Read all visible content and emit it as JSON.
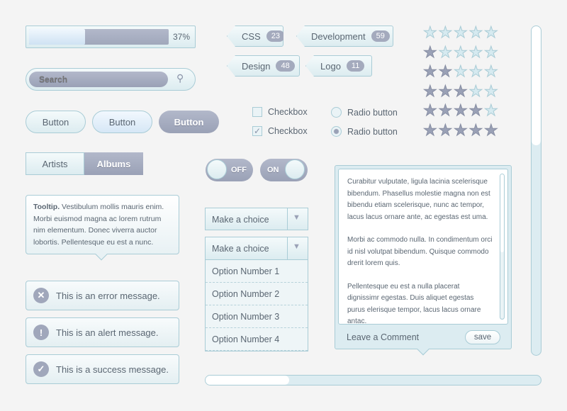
{
  "progress": {
    "value": 37,
    "label": "37%"
  },
  "search": {
    "placeholder": "Search"
  },
  "buttons": [
    "Button",
    "Button",
    "Button"
  ],
  "segmented": {
    "items": [
      "Artists",
      "Albums"
    ],
    "selected": 1
  },
  "tooltip": {
    "title": "Tooltip.",
    "body": "Vestibulum mollis mauris enim. Morbi euismod magna ac lorem rutrum nim elementum. Donec viverra auctor lobortis. Pellentesque eu est a nunc."
  },
  "messages": [
    {
      "icon": "error-icon",
      "glyph": "✕",
      "text": "This is an error message."
    },
    {
      "icon": "alert-icon",
      "glyph": "!",
      "text": "This is an alert message."
    },
    {
      "icon": "success-icon",
      "glyph": "✓",
      "text": "This is a success message."
    }
  ],
  "tags": [
    {
      "label": "CSS",
      "count": "23"
    },
    {
      "label": "Development",
      "count": "59"
    },
    {
      "label": "Design",
      "count": "48"
    },
    {
      "label": "Logo",
      "count": "11"
    }
  ],
  "checkboxes": [
    {
      "label": "Checkbox",
      "checked": false
    },
    {
      "label": "Checkbox",
      "checked": true
    }
  ],
  "radios": [
    {
      "label": "Radio button",
      "checked": false
    },
    {
      "label": "Radio button",
      "checked": true
    }
  ],
  "toggles": {
    "off": "OFF",
    "on": "ON"
  },
  "select1": {
    "value": "Make a choice"
  },
  "select2": {
    "value": "Make a choice",
    "options": [
      "Option Number 1",
      "Option Number 2",
      "Option Number 3",
      "Option Number 4"
    ]
  },
  "ratings": [
    0,
    1,
    2,
    3,
    4,
    5
  ],
  "comment": {
    "paragraphs": [
      "Curabitur vulputate, ligula lacinia scelerisque bibendum. Phasellus molestie magna non est bibendu etiam scelerisque, nunc ac tempor, lacus lacus ornare ante, ac egestas est uma.",
      "Morbi ac commodo nulla. In condimentum orci id nisl volutpat bibendum. Quisque commodo drerit lorem quis.",
      "Pellentesque eu est a nulla placerat dignissimr egestas. Duis aliquet egestas purus elerisque tempor, lacus lacus ornare antac."
    ],
    "footer": "Leave a Comment",
    "save": "save"
  },
  "hscroll": {
    "position": 0.25
  },
  "colors": {
    "light": "#dcecf0",
    "dark": "#9aa1b6",
    "border": "#a9ccd6"
  }
}
